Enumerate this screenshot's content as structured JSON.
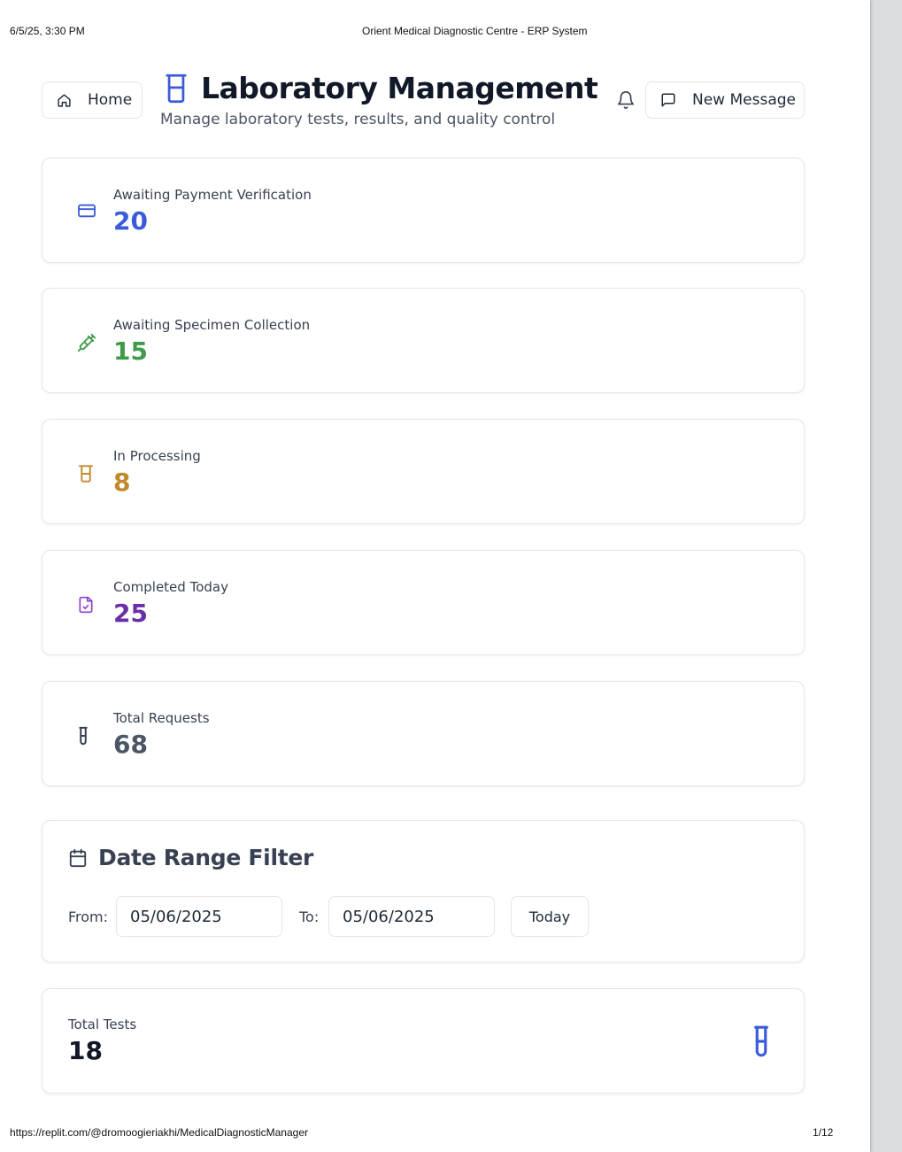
{
  "print_header": {
    "datetime": "6/5/25, 3:30 PM",
    "doc_title": "Orient Medical Diagnostic Centre - ERP System"
  },
  "print_footer": {
    "url": "https://replit.com/@dromoogieriakhi/MedicalDiagnosticManager",
    "page": "1/12"
  },
  "header": {
    "home_label": "Home",
    "title": "Laboratory Management",
    "subtitle": "Manage laboratory tests, results, and quality control",
    "new_message_label": "New Message"
  },
  "stats": [
    {
      "label": "Awaiting Payment Verification",
      "value": "20",
      "color": "#3b5bdb",
      "icon": "credit-card-icon"
    },
    {
      "label": "Awaiting Specimen Collection",
      "value": "15",
      "color": "#3f9b4a",
      "icon": "syringe-icon"
    },
    {
      "label": "In Processing",
      "value": "8",
      "color": "#c08a2c",
      "icon": "beaker-icon"
    },
    {
      "label": "Completed Today",
      "value": "25",
      "color": "#6a2fa8",
      "icon": "file-check-icon"
    },
    {
      "label": "Total Requests",
      "value": "68",
      "color": "#4b5563",
      "icon": "test-tube-icon"
    }
  ],
  "date_filter": {
    "title": "Date Range Filter",
    "from_label": "From:",
    "from_value": "05/06/2025",
    "to_label": "To:",
    "to_value": "05/06/2025",
    "today_label": "Today"
  },
  "total_tests": {
    "label": "Total Tests",
    "value": "18",
    "icon_color": "#3b5bdb"
  },
  "colors": {
    "accent": "#3b5bdb",
    "border": "#e3e6ec"
  }
}
